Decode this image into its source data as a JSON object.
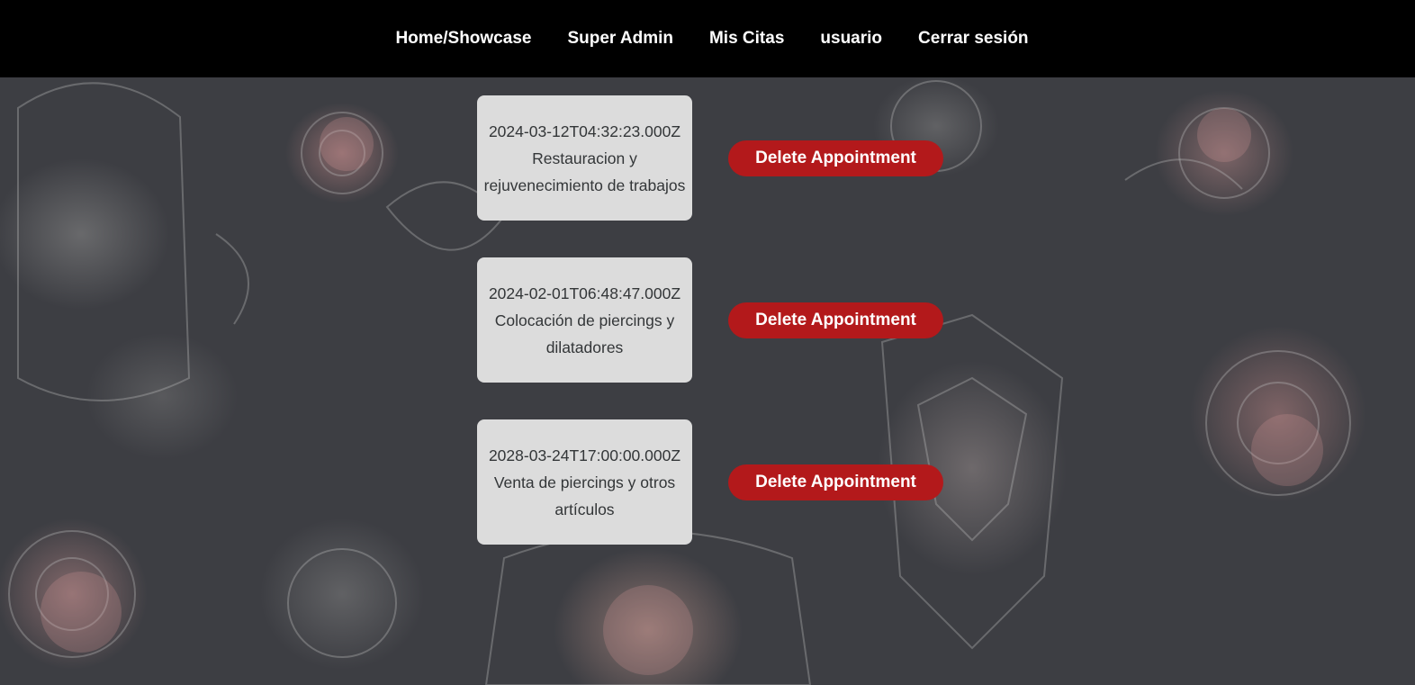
{
  "nav": {
    "items": [
      {
        "label": "Home/Showcase",
        "name": "nav-home-showcase"
      },
      {
        "label": "Super Admin",
        "name": "nav-super-admin"
      },
      {
        "label": "Mis Citas",
        "name": "nav-mis-citas"
      },
      {
        "label": "usuario",
        "name": "nav-usuario"
      },
      {
        "label": "Cerrar sesión",
        "name": "nav-cerrar-sesion"
      }
    ]
  },
  "appointments": [
    {
      "date": "2024-03-12T04:32:23.000Z",
      "service": "Restauracion y rejuvenecimiento de trabajos",
      "delete_label": "Delete Appointment"
    },
    {
      "date": "2024-02-01T06:48:47.000Z",
      "service": "Colocación de piercings y dilatadores",
      "delete_label": "Delete Appointment"
    },
    {
      "date": "2028-03-24T17:00:00.000Z",
      "service": "Venta de piercings y otros artículos",
      "delete_label": "Delete Appointment"
    }
  ],
  "colors": {
    "navbar_bg": "#000000",
    "card_bg": "#dcdcdc",
    "delete_button_bg": "#b3191b",
    "page_bg": "#3d3e43"
  }
}
